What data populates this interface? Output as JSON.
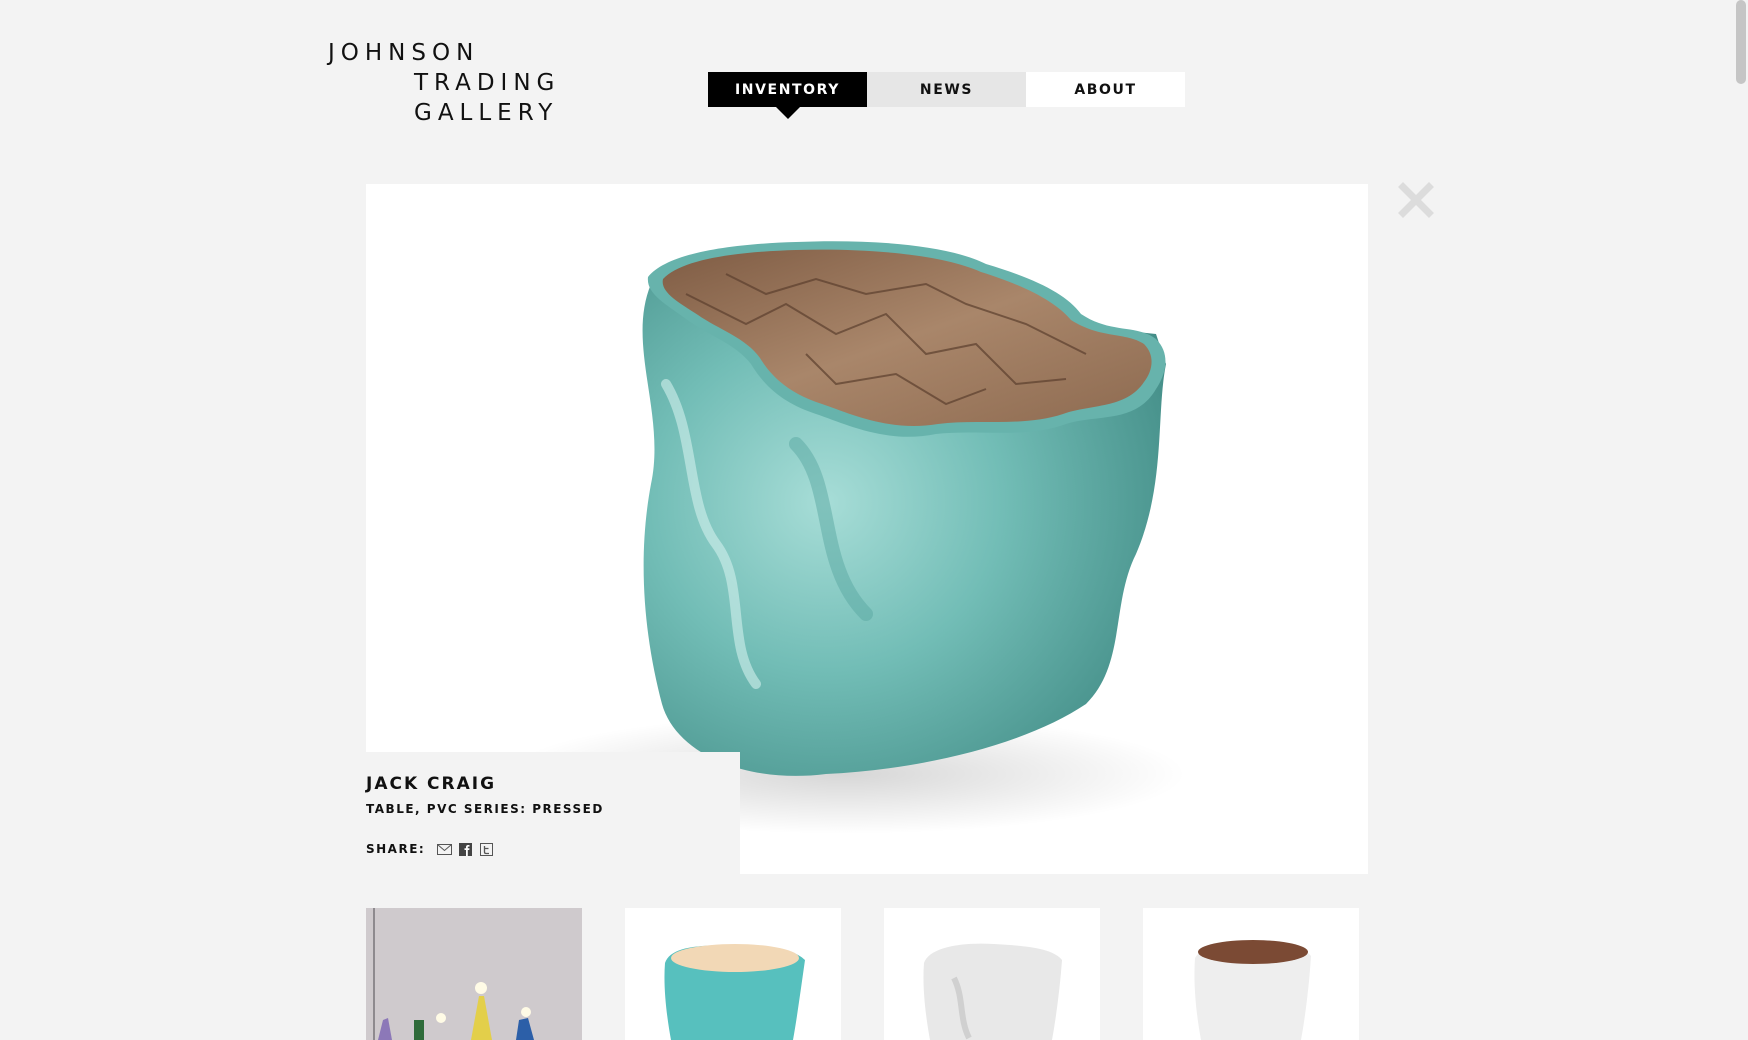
{
  "logo": {
    "line1": "JOHNSON",
    "line2": "TRADING",
    "line3": "GALLERY"
  },
  "nav": {
    "inventory": "INVENTORY",
    "news": "NEWS",
    "about": "ABOUT",
    "active": "INVENTORY"
  },
  "item": {
    "artist": "JACK CRAIG",
    "title": "TABLE, PVC SERIES: PRESSED",
    "share_label": "SHARE:"
  },
  "icons": {
    "close": "close-icon",
    "share": [
      "email-icon",
      "facebook-icon",
      "twitter-icon"
    ]
  },
  "colors": {
    "background": "#f3f3f3",
    "nav_active": "#000000",
    "teal": "#6fbcb6",
    "marble": "#8a6a52"
  }
}
